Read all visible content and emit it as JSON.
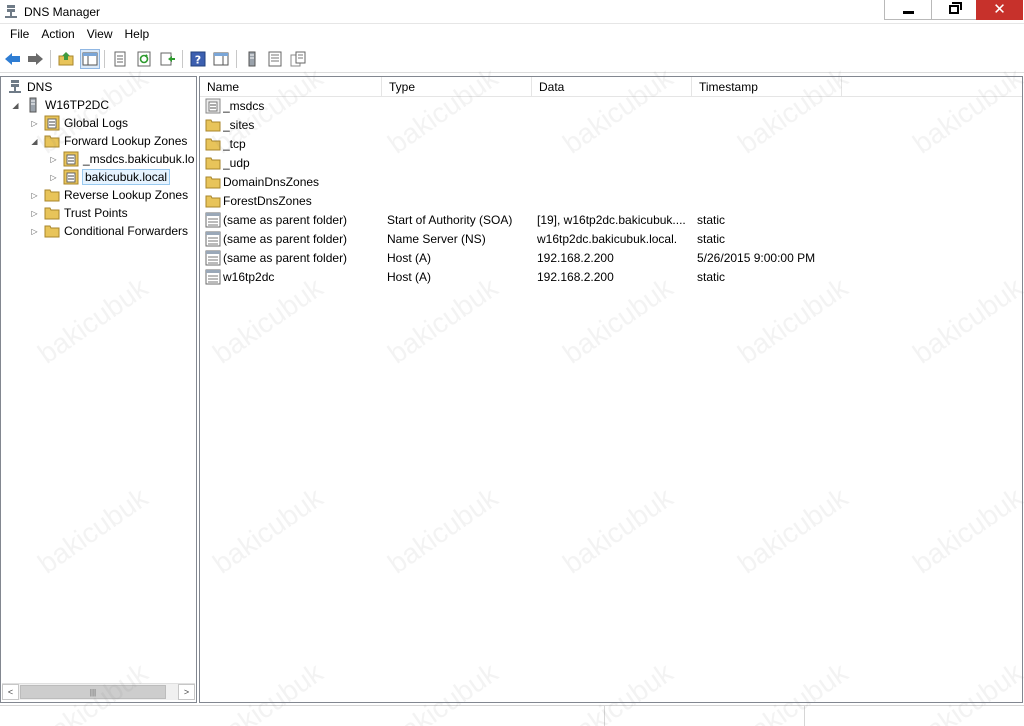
{
  "window": {
    "title": "DNS Manager"
  },
  "menu": [
    "File",
    "Action",
    "View",
    "Help"
  ],
  "toolbar": {
    "icons": [
      "back-icon",
      "forward-icon",
      "up-folder-icon",
      "show-hide-console-tree-icon",
      "properties-icon",
      "refresh-icon",
      "export-list-icon",
      "help-icon",
      "action-pane-icon",
      "server-icon",
      "zone-list-icon",
      "record-icon"
    ]
  },
  "tree": {
    "root": "DNS",
    "server": "W16TP2DC",
    "items": [
      {
        "label": "Global Logs"
      },
      {
        "label": "Forward Lookup Zones"
      },
      {
        "label": "_msdcs.bakicubuk.lo"
      },
      {
        "label": "bakicubuk.local"
      },
      {
        "label": "Reverse Lookup Zones"
      },
      {
        "label": "Trust Points"
      },
      {
        "label": "Conditional Forwarders"
      }
    ]
  },
  "list": {
    "columns": [
      "Name",
      "Type",
      "Data",
      "Timestamp"
    ],
    "rows": [
      {
        "name": "_msdcs",
        "type": "",
        "data": "",
        "timestamp": "",
        "icon": "delegated-folder-icon"
      },
      {
        "name": "_sites",
        "type": "",
        "data": "",
        "timestamp": "",
        "icon": "folder-icon"
      },
      {
        "name": "_tcp",
        "type": "",
        "data": "",
        "timestamp": "",
        "icon": "folder-icon"
      },
      {
        "name": "_udp",
        "type": "",
        "data": "",
        "timestamp": "",
        "icon": "folder-icon"
      },
      {
        "name": "DomainDnsZones",
        "type": "",
        "data": "",
        "timestamp": "",
        "icon": "folder-icon"
      },
      {
        "name": "ForestDnsZones",
        "type": "",
        "data": "",
        "timestamp": "",
        "icon": "folder-icon"
      },
      {
        "name": "(same as parent folder)",
        "type": "Start of Authority (SOA)",
        "data": "[19], w16tp2dc.bakicubuk....",
        "timestamp": "static",
        "icon": "record-icon"
      },
      {
        "name": "(same as parent folder)",
        "type": "Name Server (NS)",
        "data": "w16tp2dc.bakicubuk.local.",
        "timestamp": "static",
        "icon": "record-icon"
      },
      {
        "name": "(same as parent folder)",
        "type": "Host (A)",
        "data": "192.168.2.200",
        "timestamp": "5/26/2015 9:00:00 PM",
        "icon": "record-icon"
      },
      {
        "name": "w16tp2dc",
        "type": "Host (A)",
        "data": "192.168.2.200",
        "timestamp": "static",
        "icon": "record-icon"
      }
    ]
  },
  "watermark": "bakicubuk",
  "colors": {
    "close": "#c7312b",
    "folder": "#e8c45a",
    "selection": "#e5f3ff"
  }
}
